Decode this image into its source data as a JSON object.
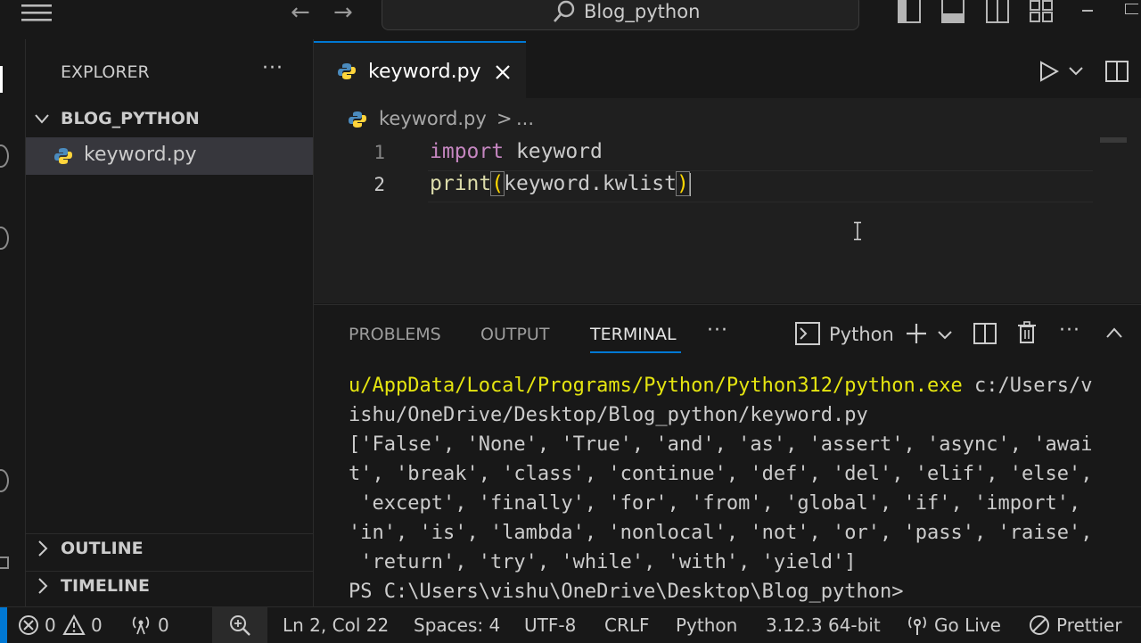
{
  "titlebar": {
    "search_text": "Blog_python"
  },
  "sidebar": {
    "title": "EXPLORER",
    "more": "···",
    "folder": "BLOG_PYTHON",
    "files": [
      {
        "name": "keyword.py"
      }
    ],
    "outline": "OUTLINE",
    "timeline": "TIMELINE"
  },
  "editor": {
    "tab_label": "keyword.py",
    "breadcrumb_file": "keyword.py",
    "breadcrumb_sep": ">",
    "breadcrumb_more": "...",
    "lines": [
      {
        "num": "1",
        "kw": "import",
        "rest": " keyword"
      },
      {
        "num": "2",
        "fn": "print",
        "open": "(",
        "arg": "keyword.kwlist",
        "close": ")"
      }
    ]
  },
  "panel": {
    "tabs": [
      "PROBLEMS",
      "OUTPUT",
      "TERMINAL"
    ],
    "active_tab": "TERMINAL",
    "more": "···",
    "shell": "Python",
    "terminal": {
      "line1_yellow": "u/AppData/Local/Programs/Python/Python312/python.exe",
      "line1_rest": " c:/Users/v",
      "line2": "ishu/OneDrive/Desktop/Blog_python/keyword.py",
      "output": [
        "['False', 'None', 'True', 'and', 'as', 'assert', 'async', 'awai",
        "t', 'break', 'class', 'continue', 'def', 'del', 'elif', 'else',",
        " 'except', 'finally', 'for', 'from', 'global', 'if', 'import',",
        "'in', 'is', 'lambda', 'nonlocal', 'not', 'or', 'pass', 'raise',",
        " 'return', 'try', 'while', 'with', 'yield']"
      ],
      "prompt": "PS C:\\Users\\vishu\\OneDrive\\Desktop\\Blog_python>"
    }
  },
  "statusbar": {
    "errors": "0",
    "warnings": "0",
    "ports": "0",
    "position": "Ln 2, Col 22",
    "spaces": "Spaces: 4",
    "encoding": "UTF-8",
    "eol": "CRLF",
    "language": "Python",
    "interpreter": "3.12.3 64-bit",
    "golive": "Go Live",
    "prettier": "Prettier"
  },
  "colors": {
    "accent": "#0078d4",
    "keyword_pink": "#c586c0",
    "function_yellow": "#dcdcaa",
    "bracket_gold": "#ffd700",
    "terminal_yellow": "#e5e510"
  }
}
